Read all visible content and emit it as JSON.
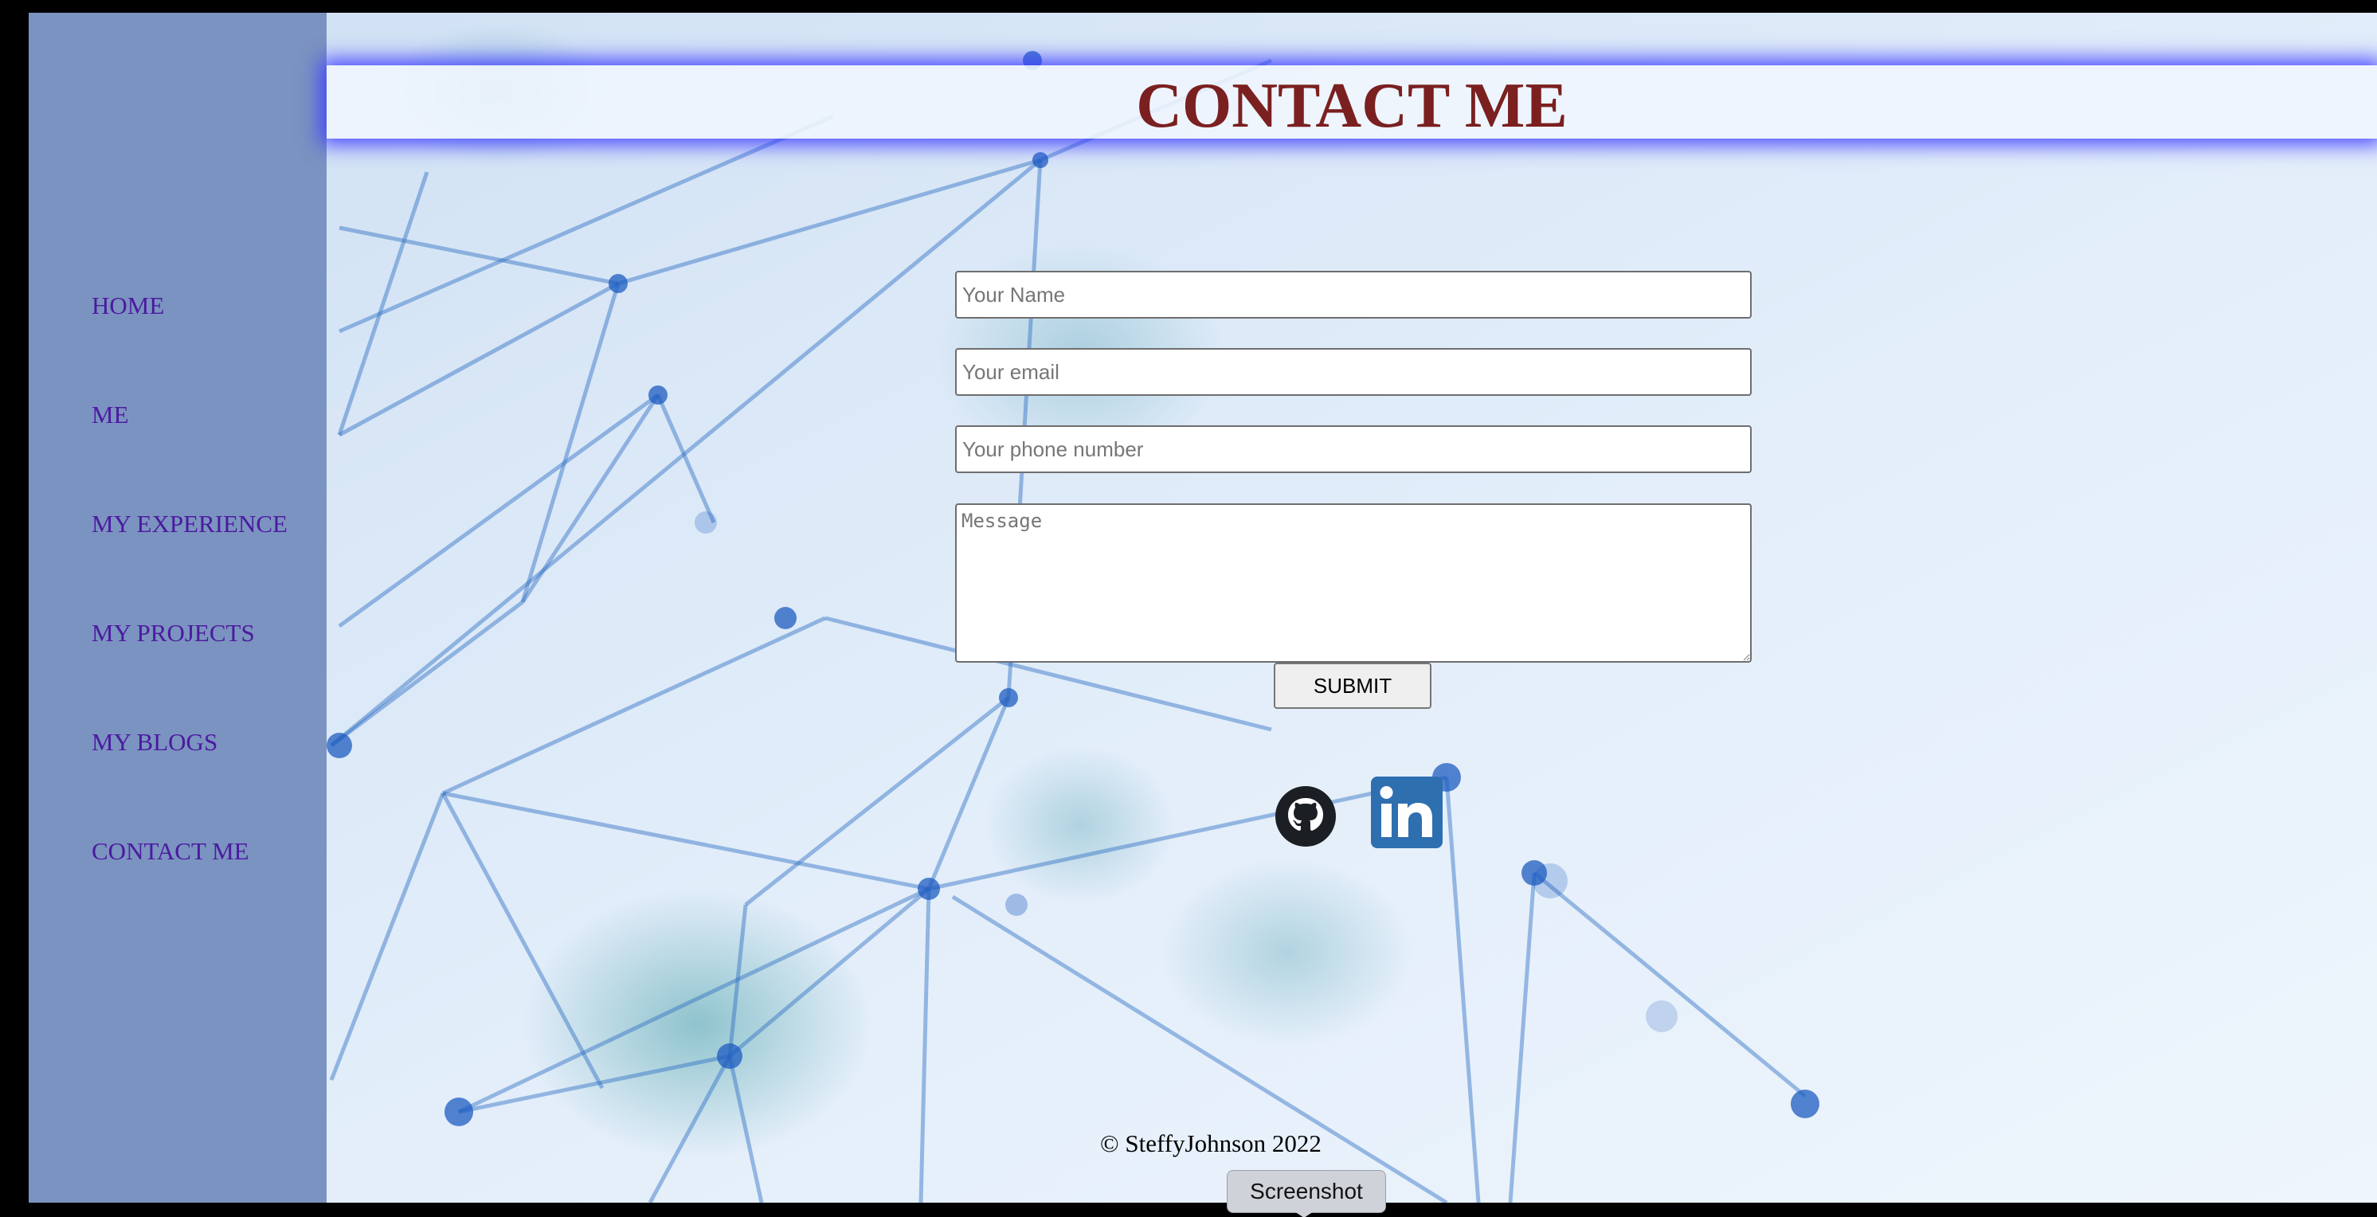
{
  "header": {
    "title": "CONTACT ME"
  },
  "sidebar": {
    "items": [
      {
        "label": "HOME"
      },
      {
        "label": "ME"
      },
      {
        "label": "MY EXPERIENCE"
      },
      {
        "label": "MY PROJECTS"
      },
      {
        "label": "MY BLOGS"
      },
      {
        "label": "CONTACT ME"
      }
    ]
  },
  "form": {
    "name_placeholder": "Your Name",
    "email_placeholder": "Your email",
    "phone_placeholder": "Your phone number",
    "message_placeholder": "Message",
    "submit_label": "SUBMIT"
  },
  "social": {
    "icons": [
      "github-icon",
      "linkedin-icon"
    ]
  },
  "footer": {
    "text": "© SteffyJohnson 2022"
  },
  "tooltip": {
    "text": "Screenshot"
  },
  "colors": {
    "sidebar_bg": "#7b93c0",
    "nav_link": "#4b1aa0",
    "title": "#7a2020",
    "header_glow": "#3c3cff",
    "linkedin": "#2e6fb0"
  }
}
